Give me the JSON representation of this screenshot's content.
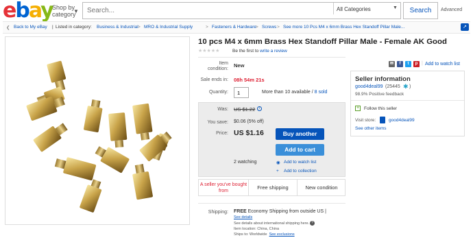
{
  "header": {
    "logo": {
      "e": "e",
      "b": "b",
      "a": "a",
      "y": "y"
    },
    "shop_by_category": "Shop by category",
    "search_placeholder": "Search...",
    "category_select": "All Categories",
    "search_button": "Search",
    "advanced": "Advanced"
  },
  "breadcrumb": {
    "back": "Back to My eBay",
    "listed_in": "Listed in category:",
    "items": [
      "Business & Industrial",
      "MRO & Industrial Supply",
      "Fasteners & Hardware",
      "Screws",
      "See more 10 Pcs M4 x 6mm Brass Hex Standoff Pillar Male..."
    ],
    "separator": ">"
  },
  "listing": {
    "title": "10 pcs M4 x 6mm Brass Hex Standoff Pillar Male - Female AK Good",
    "review_prefix": "Be the first to",
    "review_link": "write a review",
    "condition_label": "Item condition:",
    "condition_value": "New",
    "sale_ends_label": "Sale ends in:",
    "sale_ends_value": "08h 54m 21s",
    "quantity_label": "Quantity:",
    "quantity_value": "1",
    "available": "More than 10 available /",
    "sold": "8 sold",
    "was_label": "Was:",
    "was_value": "US $1.22",
    "save_label": "You save:",
    "save_value": "$0.06 (5% off)",
    "price_label": "Price:",
    "price_value": "US $1.16",
    "buy_button": "Buy another",
    "cart_button": "Add to cart",
    "watching": "2 watching",
    "add_watch": "Add to watch list",
    "add_collection": "Add to collection",
    "features": [
      "A seller you've bought from",
      "Free shipping",
      "New condition"
    ],
    "shipping_label": "Shipping:",
    "shipping_free": "FREE",
    "shipping_text": "Economy Shipping from outside US |",
    "see_details": "See details",
    "intl_note": "See details about international shipping here.",
    "item_location": "Item location:  China, China",
    "ships_to": "Ships to:  Worldwide",
    "see_exclusions": "See exclusions"
  },
  "sidebar": {
    "social": [
      "email",
      "facebook",
      "twitter",
      "pinterest"
    ],
    "watch_link": "Add to watch list",
    "seller_heading": "Seller information",
    "seller_name": "good4deal99",
    "seller_score": "(25445",
    "seller_score_close": ")",
    "feedback": "98.9% Positive feedback",
    "follow": "Follow this seller",
    "visit_store": "Visit store:",
    "store_name": "good4deal99",
    "other_items": "See other items"
  },
  "colors": {
    "link": "#0654ba",
    "red": "#dd1e31",
    "buy": "#0654ba",
    "cart": "#3a8fd9"
  }
}
